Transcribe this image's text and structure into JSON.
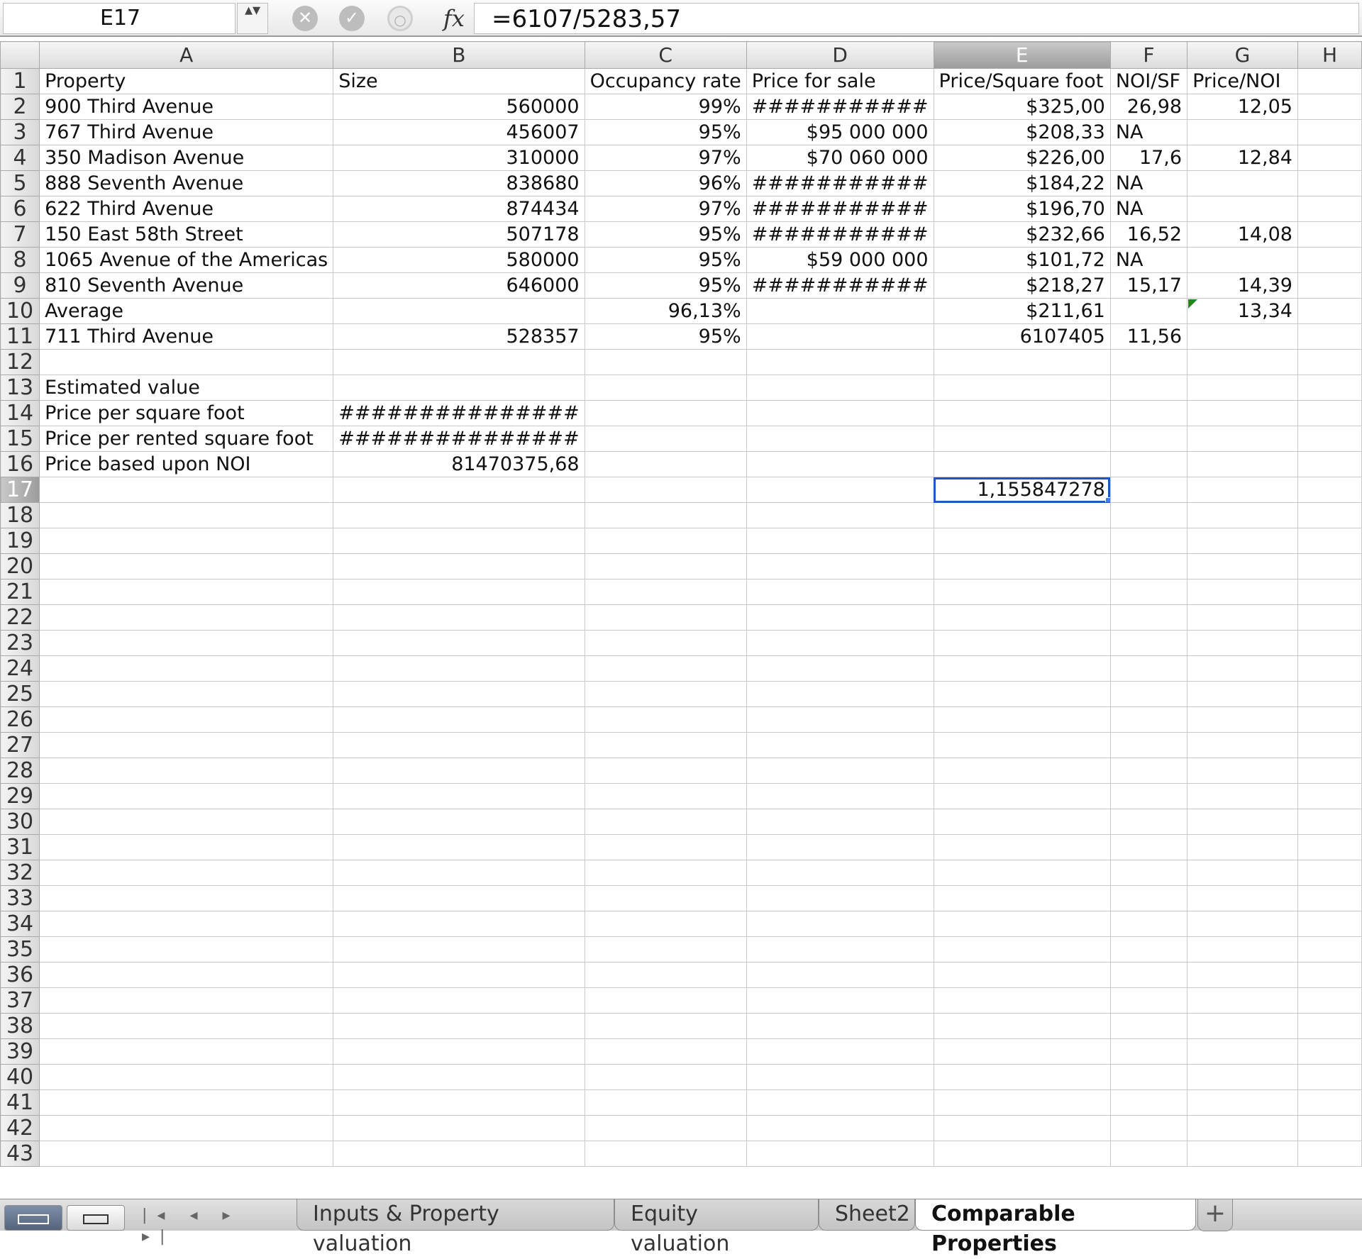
{
  "formula_bar": {
    "name_box": "E17",
    "stepper": "▴▾",
    "cancel_icon": "✕",
    "enter_icon": "✓",
    "function_icon": "○",
    "fx": "fx",
    "formula": "=6107/5283,57"
  },
  "columns": [
    "A",
    "B",
    "C",
    "D",
    "E",
    "F",
    "G",
    "H"
  ],
  "selected_column": "E",
  "selected_row": 17,
  "rows": [
    {
      "n": "1",
      "cells": [
        "Property",
        "Size",
        "Occupancy rate",
        "Price for sale",
        "Price/Square foot",
        "NOI/SF",
        "Price/NOI",
        ""
      ]
    },
    {
      "n": "2",
      "cells": [
        "900 Third Avenue",
        "560000",
        "99%",
        "###########",
        "$325,00",
        "26,98",
        "12,05",
        ""
      ]
    },
    {
      "n": "3",
      "cells": [
        "767 Third Avenue",
        "456007",
        "95%",
        "$95 000 000",
        "$208,33",
        "NA",
        "",
        ""
      ]
    },
    {
      "n": "4",
      "cells": [
        "350 Madison Avenue",
        "310000",
        "97%",
        "$70 060 000",
        "$226,00",
        "17,6",
        "12,84",
        ""
      ]
    },
    {
      "n": "5",
      "cells": [
        "888 Seventh Avenue",
        "838680",
        "96%",
        "###########",
        "$184,22",
        "NA",
        "",
        ""
      ]
    },
    {
      "n": "6",
      "cells": [
        "622 Third Avenue",
        "874434",
        "97%",
        "###########",
        "$196,70",
        "NA",
        "",
        ""
      ]
    },
    {
      "n": "7",
      "cells": [
        "150 East 58th Street",
        "507178",
        "95%",
        "###########",
        "$232,66",
        "16,52",
        "14,08",
        ""
      ]
    },
    {
      "n": "8",
      "cells": [
        "1065 Avenue of the Americas",
        "580000",
        "95%",
        "$59 000 000",
        "$101,72",
        "NA",
        "",
        ""
      ]
    },
    {
      "n": "9",
      "cells": [
        "810 Seventh Avenue",
        "646000",
        "95%",
        "###########",
        "$218,27",
        "15,17",
        "14,39",
        ""
      ]
    },
    {
      "n": "10",
      "cells": [
        "Average",
        "",
        "96,13%",
        "",
        "$211,61",
        "",
        "13,34",
        ""
      ]
    },
    {
      "n": "11",
      "cells": [
        "711 Third Avenue",
        "528357",
        "95%",
        "",
        "6107405",
        "11,56",
        "",
        ""
      ]
    },
    {
      "n": "12",
      "cells": [
        "",
        "",
        "",
        "",
        "",
        "",
        "",
        ""
      ]
    },
    {
      "n": "13",
      "cells": [
        "Estimated value",
        "",
        "",
        "",
        "",
        "",
        "",
        ""
      ]
    },
    {
      "n": "14",
      "cells": [
        "Price per square foot",
        "###############",
        "",
        "",
        "",
        "",
        "",
        ""
      ]
    },
    {
      "n": "15",
      "cells": [
        "Price per rented square foot",
        "###############",
        "",
        "",
        "",
        "",
        "",
        ""
      ]
    },
    {
      "n": "16",
      "cells": [
        "Price based upon NOI",
        "81470375,68",
        "",
        "",
        "",
        "",
        "",
        ""
      ]
    },
    {
      "n": "17",
      "cells": [
        "",
        "",
        "",
        "",
        "1,155847278",
        "",
        "",
        ""
      ]
    }
  ],
  "empty_rows": [
    "18",
    "19",
    "20",
    "21",
    "22",
    "23",
    "24",
    "25",
    "26",
    "27",
    "28",
    "29",
    "30",
    "31",
    "32",
    "33",
    "34",
    "35",
    "36",
    "37",
    "38",
    "39",
    "40",
    "41",
    "42",
    "43"
  ],
  "tab_bar": {
    "nav_arrows": "|◂ ◂ ▸ ▸|",
    "tabs": [
      "Inputs & Property valuation",
      "Equity valuation",
      "Sheet2",
      "Comparable Properties"
    ],
    "active_tab": "Comparable Properties",
    "add_label": "+"
  },
  "colors": {
    "selection_border": "#1f55c9",
    "comment_marker": "#1a8a1a"
  }
}
